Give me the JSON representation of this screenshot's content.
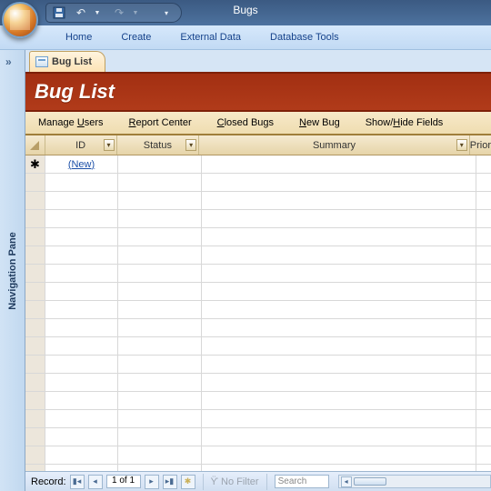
{
  "title": "Bugs",
  "ribbon_tabs": [
    "Home",
    "Create",
    "External Data",
    "Database Tools"
  ],
  "navpane_label": "Navigation Pane",
  "doc_tab": "Bug List",
  "header_title": "Bug List",
  "sandbar": {
    "manage_users_pre": "Manage ",
    "manage_users_u": "U",
    "manage_users_post": "sers",
    "report_center_u": "R",
    "report_center_post": "eport Center",
    "closed_bugs_pre": "",
    "closed_bugs_u": "C",
    "closed_bugs_post": "losed Bugs",
    "new_bug_u": "N",
    "new_bug_post": "ew Bug",
    "showhide_pre": "Show/",
    "showhide_u": "H",
    "showhide_post": "ide Fields"
  },
  "columns": [
    "ID",
    "Status",
    "Summary",
    "Prior"
  ],
  "new_row_link": "(New)",
  "recordbar": {
    "label": "Record:",
    "position": "1 of 1",
    "nofilter": "No Filter",
    "search_placeholder": "Search"
  }
}
